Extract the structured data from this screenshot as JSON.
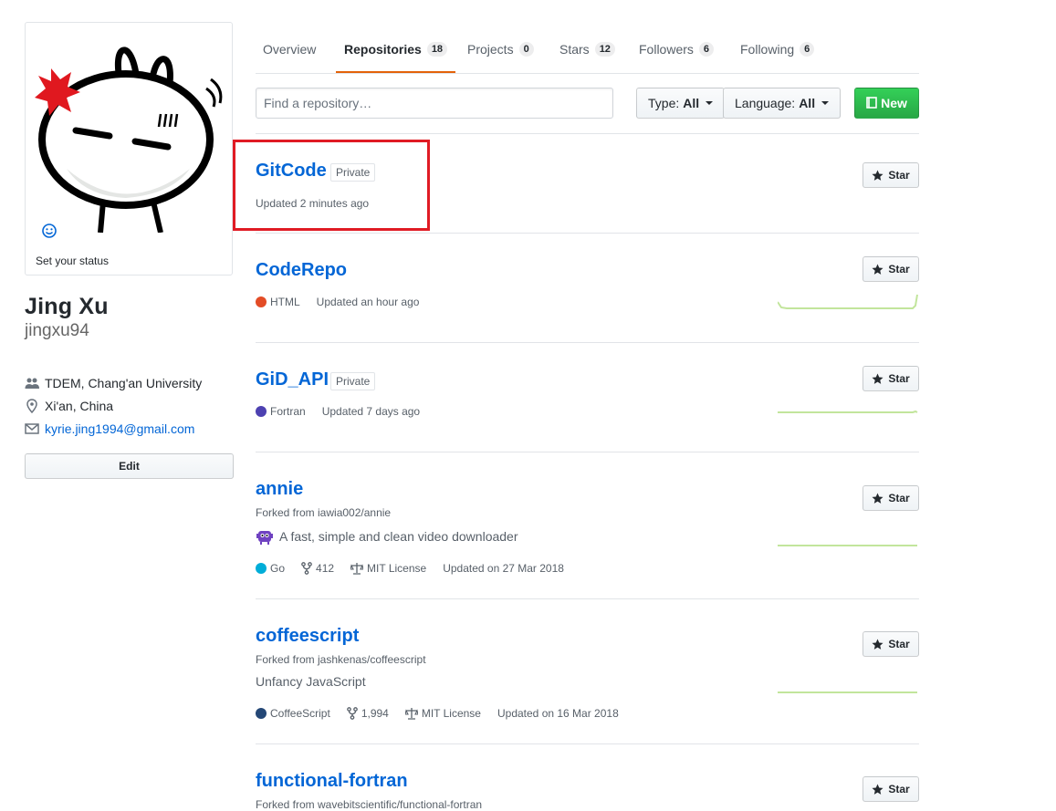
{
  "profile": {
    "set_status": "Set your status",
    "name": "Jing Xu",
    "login": "jingxu94",
    "organization": "TDEM, Chang'an University",
    "location": "Xi'an, China",
    "email": "kyrie.jing1994@gmail.com",
    "edit_label": "Edit"
  },
  "tabs": [
    {
      "label": "Overview",
      "count": null
    },
    {
      "label": "Repositories",
      "count": "18"
    },
    {
      "label": "Projects",
      "count": "0"
    },
    {
      "label": "Stars",
      "count": "12"
    },
    {
      "label": "Followers",
      "count": "6"
    },
    {
      "label": "Following",
      "count": "6"
    }
  ],
  "filters": {
    "search_placeholder": "Find a repository…",
    "type_label": "Type:",
    "type_value": "All",
    "language_label": "Language:",
    "language_value": "All",
    "new_label": "New"
  },
  "star_label": "Star",
  "repos": [
    {
      "name": "GitCode",
      "badge": "Private",
      "updated": "Updated 2 minutes ago"
    },
    {
      "name": "CodeRepo",
      "language": "HTML",
      "lang_color": "#e34c26",
      "updated": "Updated an hour ago"
    },
    {
      "name": "GiD_API",
      "badge": "Private",
      "language": "Fortran",
      "lang_color": "#4d41b1",
      "updated": "Updated 7 days ago"
    },
    {
      "name": "annie",
      "fork": "Forked from iawia002/annie",
      "description": "A fast, simple and clean video downloader",
      "language": "Go",
      "lang_color": "#00add8",
      "forks": "412",
      "license": "MIT License",
      "updated": "Updated on 27 Mar 2018"
    },
    {
      "name": "coffeescript",
      "fork": "Forked from jashkenas/coffeescript",
      "description": "Unfancy JavaScript",
      "language": "CoffeeScript",
      "lang_color": "#244776",
      "forks": "1,994",
      "license": "MIT License",
      "updated": "Updated on 16 Mar 2018"
    },
    {
      "name": "functional-fortran",
      "fork": "Forked from wavebitscientific/functional-fortran"
    }
  ],
  "colors": {
    "link": "#0366d6",
    "highlight_box": "#e01b24",
    "new_button": "#28a745",
    "tab_underline": "#e36209",
    "sparkline": "#c2e59c"
  }
}
